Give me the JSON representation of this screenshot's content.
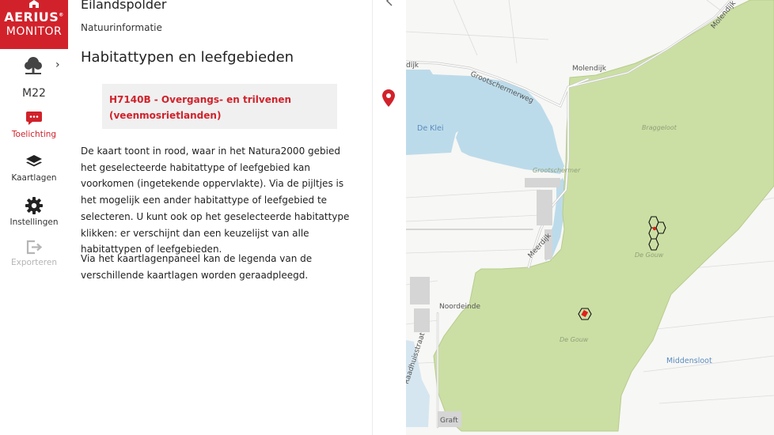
{
  "brand": {
    "line1": "AERIUS",
    "line2": "MONITOR"
  },
  "sidebar": {
    "area_code": "M22",
    "nav": [
      {
        "label": "Toelichting",
        "icon": "comment-icon",
        "active": true,
        "disabled": false
      },
      {
        "label": "Kaartlagen",
        "icon": "layers-icon",
        "active": false,
        "disabled": false
      },
      {
        "label": "Instellingen",
        "icon": "gear-icon",
        "active": false,
        "disabled": false
      },
      {
        "label": "Exporteren",
        "icon": "export-icon",
        "active": false,
        "disabled": true
      }
    ]
  },
  "panel": {
    "title": "Eilandspolder",
    "subtitle": "Natuurinformatie",
    "heading": "Habitattypen en leefgebieden",
    "habitat_selected": "H7140B - Overgangs- en trilvenen (veenmosrietlanden)",
    "paragraph1": "De kaart toont in rood, waar in het Natura2000 gebied het geselecteerde habitattype of leefgebied kan voorkomen (ingetekende oppervlakte). Via de pijltjes is het mogelijk een ander habitattype of leefgebied te selecteren. U kunt ook op het geselecteerde habitattype klikken: er verschijnt dan een keuzelijst van alle habitattypen of leefgebieden.",
    "paragraph2": "Via het kaartlagenpaneel kan de legenda van de verschillende kaartlagen worden geraadpleegd."
  },
  "map": {
    "labels": {
      "grootschermerweg": "Grootschermerweg",
      "molendijk_top": "Molendijk",
      "molendijk_mid": "Molendijk",
      "dijk_left": "dijk",
      "meerdijk": "Meerdijk",
      "noordeinde": "Noordeinde",
      "middensloot": "Middensloot",
      "raadhuisstraat": "Raadhuisstraat",
      "graft": "Graft",
      "de_klei": "De Klei",
      "grootschermer": "Grootschermer",
      "braggeloot": "Braggeloot",
      "de_gouw_1": "De Gouw",
      "de_gouw_2": "De Gouw"
    },
    "colors": {
      "nature_area": "#cbdfa4",
      "water": "#bcdbea",
      "habitat_marker": "#e0201a",
      "accent": "#d1222b"
    }
  }
}
